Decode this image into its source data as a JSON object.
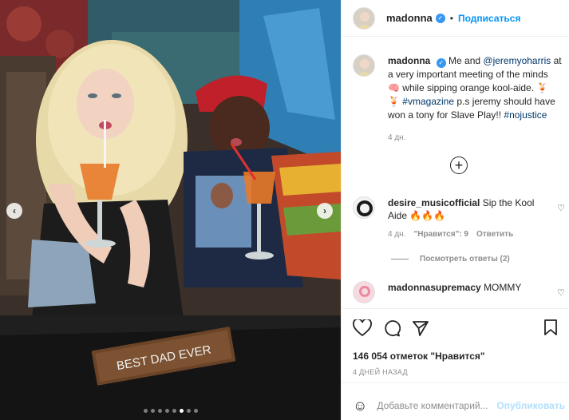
{
  "post": {
    "username": "madonna",
    "follow_label": "Подписаться",
    "separator": "•"
  },
  "caption": {
    "username": "madonna",
    "text_1": "Me and ",
    "mention": "@jeremyoharris",
    "text_2": " at a very important meeting of the minds 🧠 while sipping orange kool-aide. 🍹",
    "emoji_2": "🍹",
    "hashtag_1": "#vmagazine",
    "text_3": " p.s jeremy should have won a tony for Slave Play!! ",
    "hashtag_2": "#nojustice",
    "time": "4 дн."
  },
  "comments": [
    {
      "username": "desire_musicofficial",
      "text": "Sip the Kool Aide 🔥🔥🔥",
      "time": "4 дн.",
      "likes": "\"Нравится\": 9",
      "reply": "Ответить",
      "view_replies": "Посмотреть ответы (2)"
    },
    {
      "username": "madonnasupremacy",
      "text": "MOMMY"
    }
  ],
  "likes_label": "146 054 отметок \"Нравится\"",
  "date_label": "4 ДНЕЙ НАЗАД",
  "add_comment": {
    "placeholder": "Добавьте комментарий...",
    "post_label": "Опубликовать"
  },
  "photo": {
    "sign_text": "BEST DAD EVER",
    "slide_count": 8,
    "active_slide": 6
  },
  "icons": {
    "verified": "verified-badge-icon",
    "heart": "heart-icon",
    "comment": "comment-icon",
    "share": "share-icon",
    "bookmark": "bookmark-icon",
    "emoji": "emoji-icon",
    "add": "plus-circle-icon"
  },
  "colors": {
    "link": "#00376b",
    "follow": "#0095f6",
    "verified": "#3897f0",
    "muted": "#8e8e8e"
  }
}
